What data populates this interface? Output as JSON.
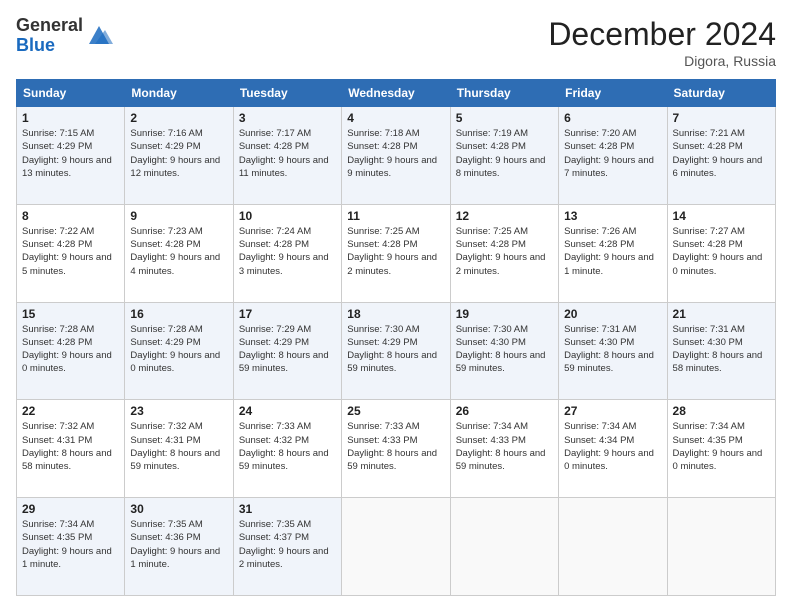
{
  "header": {
    "logo_general": "General",
    "logo_blue": "Blue",
    "month_title": "December 2024",
    "location": "Digora, Russia"
  },
  "days_of_week": [
    "Sunday",
    "Monday",
    "Tuesday",
    "Wednesday",
    "Thursday",
    "Friday",
    "Saturday"
  ],
  "weeks": [
    [
      {
        "day": "1",
        "sunrise": "Sunrise: 7:15 AM",
        "sunset": "Sunset: 4:29 PM",
        "daylight": "Daylight: 9 hours and 13 minutes."
      },
      {
        "day": "2",
        "sunrise": "Sunrise: 7:16 AM",
        "sunset": "Sunset: 4:29 PM",
        "daylight": "Daylight: 9 hours and 12 minutes."
      },
      {
        "day": "3",
        "sunrise": "Sunrise: 7:17 AM",
        "sunset": "Sunset: 4:28 PM",
        "daylight": "Daylight: 9 hours and 11 minutes."
      },
      {
        "day": "4",
        "sunrise": "Sunrise: 7:18 AM",
        "sunset": "Sunset: 4:28 PM",
        "daylight": "Daylight: 9 hours and 9 minutes."
      },
      {
        "day": "5",
        "sunrise": "Sunrise: 7:19 AM",
        "sunset": "Sunset: 4:28 PM",
        "daylight": "Daylight: 9 hours and 8 minutes."
      },
      {
        "day": "6",
        "sunrise": "Sunrise: 7:20 AM",
        "sunset": "Sunset: 4:28 PM",
        "daylight": "Daylight: 9 hours and 7 minutes."
      },
      {
        "day": "7",
        "sunrise": "Sunrise: 7:21 AM",
        "sunset": "Sunset: 4:28 PM",
        "daylight": "Daylight: 9 hours and 6 minutes."
      }
    ],
    [
      {
        "day": "8",
        "sunrise": "Sunrise: 7:22 AM",
        "sunset": "Sunset: 4:28 PM",
        "daylight": "Daylight: 9 hours and 5 minutes."
      },
      {
        "day": "9",
        "sunrise": "Sunrise: 7:23 AM",
        "sunset": "Sunset: 4:28 PM",
        "daylight": "Daylight: 9 hours and 4 minutes."
      },
      {
        "day": "10",
        "sunrise": "Sunrise: 7:24 AM",
        "sunset": "Sunset: 4:28 PM",
        "daylight": "Daylight: 9 hours and 3 minutes."
      },
      {
        "day": "11",
        "sunrise": "Sunrise: 7:25 AM",
        "sunset": "Sunset: 4:28 PM",
        "daylight": "Daylight: 9 hours and 2 minutes."
      },
      {
        "day": "12",
        "sunrise": "Sunrise: 7:25 AM",
        "sunset": "Sunset: 4:28 PM",
        "daylight": "Daylight: 9 hours and 2 minutes."
      },
      {
        "day": "13",
        "sunrise": "Sunrise: 7:26 AM",
        "sunset": "Sunset: 4:28 PM",
        "daylight": "Daylight: 9 hours and 1 minute."
      },
      {
        "day": "14",
        "sunrise": "Sunrise: 7:27 AM",
        "sunset": "Sunset: 4:28 PM",
        "daylight": "Daylight: 9 hours and 0 minutes."
      }
    ],
    [
      {
        "day": "15",
        "sunrise": "Sunrise: 7:28 AM",
        "sunset": "Sunset: 4:28 PM",
        "daylight": "Daylight: 9 hours and 0 minutes."
      },
      {
        "day": "16",
        "sunrise": "Sunrise: 7:28 AM",
        "sunset": "Sunset: 4:29 PM",
        "daylight": "Daylight: 9 hours and 0 minutes."
      },
      {
        "day": "17",
        "sunrise": "Sunrise: 7:29 AM",
        "sunset": "Sunset: 4:29 PM",
        "daylight": "Daylight: 8 hours and 59 minutes."
      },
      {
        "day": "18",
        "sunrise": "Sunrise: 7:30 AM",
        "sunset": "Sunset: 4:29 PM",
        "daylight": "Daylight: 8 hours and 59 minutes."
      },
      {
        "day": "19",
        "sunrise": "Sunrise: 7:30 AM",
        "sunset": "Sunset: 4:30 PM",
        "daylight": "Daylight: 8 hours and 59 minutes."
      },
      {
        "day": "20",
        "sunrise": "Sunrise: 7:31 AM",
        "sunset": "Sunset: 4:30 PM",
        "daylight": "Daylight: 8 hours and 59 minutes."
      },
      {
        "day": "21",
        "sunrise": "Sunrise: 7:31 AM",
        "sunset": "Sunset: 4:30 PM",
        "daylight": "Daylight: 8 hours and 58 minutes."
      }
    ],
    [
      {
        "day": "22",
        "sunrise": "Sunrise: 7:32 AM",
        "sunset": "Sunset: 4:31 PM",
        "daylight": "Daylight: 8 hours and 58 minutes."
      },
      {
        "day": "23",
        "sunrise": "Sunrise: 7:32 AM",
        "sunset": "Sunset: 4:31 PM",
        "daylight": "Daylight: 8 hours and 59 minutes."
      },
      {
        "day": "24",
        "sunrise": "Sunrise: 7:33 AM",
        "sunset": "Sunset: 4:32 PM",
        "daylight": "Daylight: 8 hours and 59 minutes."
      },
      {
        "day": "25",
        "sunrise": "Sunrise: 7:33 AM",
        "sunset": "Sunset: 4:33 PM",
        "daylight": "Daylight: 8 hours and 59 minutes."
      },
      {
        "day": "26",
        "sunrise": "Sunrise: 7:34 AM",
        "sunset": "Sunset: 4:33 PM",
        "daylight": "Daylight: 8 hours and 59 minutes."
      },
      {
        "day": "27",
        "sunrise": "Sunrise: 7:34 AM",
        "sunset": "Sunset: 4:34 PM",
        "daylight": "Daylight: 9 hours and 0 minutes."
      },
      {
        "day": "28",
        "sunrise": "Sunrise: 7:34 AM",
        "sunset": "Sunset: 4:35 PM",
        "daylight": "Daylight: 9 hours and 0 minutes."
      }
    ],
    [
      {
        "day": "29",
        "sunrise": "Sunrise: 7:34 AM",
        "sunset": "Sunset: 4:35 PM",
        "daylight": "Daylight: 9 hours and 1 minute."
      },
      {
        "day": "30",
        "sunrise": "Sunrise: 7:35 AM",
        "sunset": "Sunset: 4:36 PM",
        "daylight": "Daylight: 9 hours and 1 minute."
      },
      {
        "day": "31",
        "sunrise": "Sunrise: 7:35 AM",
        "sunset": "Sunset: 4:37 PM",
        "daylight": "Daylight: 9 hours and 2 minutes."
      },
      null,
      null,
      null,
      null
    ]
  ]
}
